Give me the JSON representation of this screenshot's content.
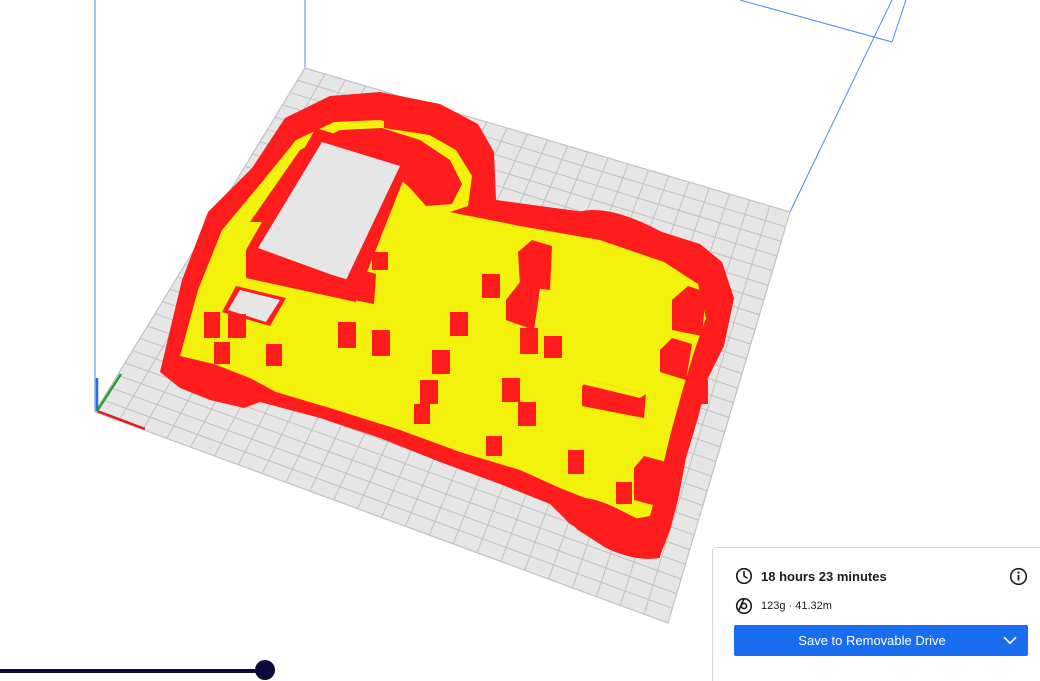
{
  "viewport": {
    "colors": {
      "build_plate": "#e6e6e6",
      "grid_lines": "#c2c2c2",
      "volume_edges": "#4a8cf0",
      "model_wall": "#ff1c1c",
      "model_infill": "#f2f20c",
      "axis_x": "#e02020",
      "axis_y": "#2aa02a",
      "axis_z": "#2a6ae8"
    }
  },
  "print_info": {
    "time_icon": "clock-icon",
    "print_time": "18 hours 23 minutes",
    "material_icon": "filament-spool-icon",
    "material": "123g · 41.32m",
    "info_icon": "info-icon"
  },
  "save_button": {
    "label": "Save to Removable Drive",
    "dropdown_icon": "chevron-down-icon",
    "color": "#196ef0"
  },
  "layer_slider": {
    "color": "#0a0a3d",
    "position": 1.0
  }
}
